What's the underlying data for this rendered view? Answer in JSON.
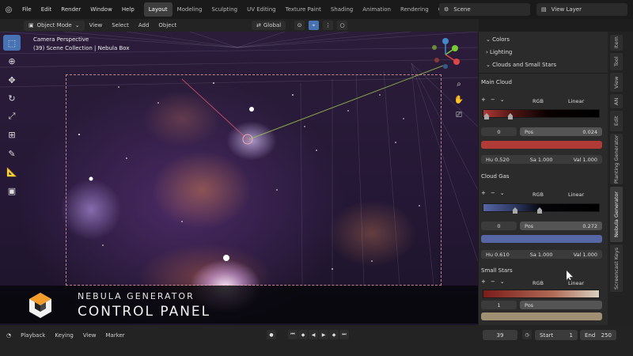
{
  "menus": [
    "File",
    "Edit",
    "Render",
    "Window",
    "Help"
  ],
  "workspaces": [
    "Layout",
    "Modeling",
    "Sculpting",
    "UV Editing",
    "Texture Paint",
    "Shading",
    "Animation",
    "Rendering",
    "Compo"
  ],
  "scene_label": "Scene",
  "view_layer_label": "View Layer",
  "viewport_header": {
    "mode": "Object Mode",
    "menus": [
      "View",
      "Select",
      "Add",
      "Object"
    ],
    "transform": "Global"
  },
  "viewport": {
    "camera_label": "Camera Perspective",
    "collection_label": "(39) Scene Collection | Nebula Box"
  },
  "overlay": {
    "line1": "NEBULA GENERATOR",
    "line2": "CONTROL PANEL"
  },
  "props": {
    "sections": [
      "Colors",
      "Lighting",
      "Clouds and Small Stars"
    ],
    "main_cloud": {
      "title": "Main Cloud",
      "color_mode": "RGB",
      "interp": "Linear",
      "index": "0",
      "pos_label": "Pos",
      "pos": "0.024",
      "color": "#b03a35",
      "hu_label": "Hu",
      "hu": "0.520",
      "sa_label": "Sa",
      "sa": "1.000",
      "val_label": "Val",
      "val": "1.000"
    },
    "cloud_gas": {
      "title": "Cloud Gas",
      "color_mode": "RGB",
      "interp": "Linear",
      "index": "0",
      "pos_label": "Pos",
      "pos": "0.272",
      "color": "#5766a5",
      "hu_label": "Hu",
      "hu": "0.610",
      "sa_label": "Sa",
      "sa": "1.000",
      "val_label": "Val",
      "val": "1.000"
    },
    "small_stars": {
      "title": "Small Stars",
      "color_mode": "RGB",
      "interp": "Linear",
      "index": "1",
      "pos_label": "Pos",
      "pos": "",
      "color": "#a08f72"
    }
  },
  "side_tabs": [
    "Item",
    "Tool",
    "View",
    "AN",
    "Edit",
    "Planting Generator",
    "Nebula Generator",
    "Screencast Keys"
  ],
  "timeline": {
    "menus": [
      "Playback",
      "Keying",
      "View",
      "Marker"
    ],
    "current_frame": "39",
    "start_label": "Start",
    "start": "1",
    "end_label": "End",
    "end": "250"
  }
}
